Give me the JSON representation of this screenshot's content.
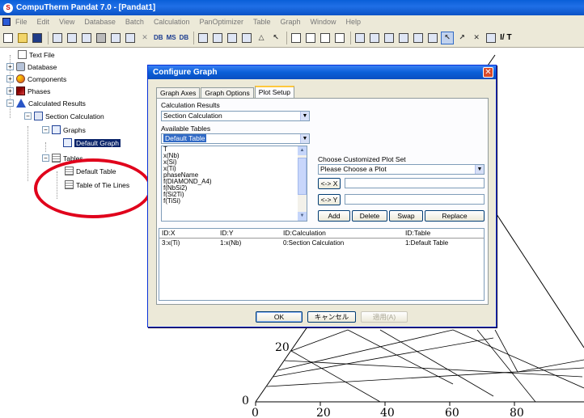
{
  "app": {
    "title": "CompuTherm Pandat 7.0 - [Pandat1]",
    "icon_label": "S",
    "menu": [
      "File",
      "Edit",
      "View",
      "Database",
      "Batch",
      "Calculation",
      "PanOptimizer",
      "Table",
      "Graph",
      "Window",
      "Help"
    ]
  },
  "toolbar": {
    "text_buttons": [
      "DB",
      "MS",
      "DB"
    ],
    "tail_text": "I/ T"
  },
  "tree": {
    "items": [
      {
        "label": "Text File",
        "icon": "text-file-icon"
      },
      {
        "label": "Database",
        "icon": "database-icon"
      },
      {
        "label": "Components",
        "icon": "components-icon"
      },
      {
        "label": "Phases",
        "icon": "phases-icon"
      },
      {
        "label": "Calculated Results",
        "icon": "calculated-results-icon"
      },
      {
        "label": "Section Calculation",
        "icon": "section-calculation-icon"
      },
      {
        "label": "Graphs",
        "icon": "graph-folder-icon"
      },
      {
        "label": "Default Graph",
        "icon": "graph-icon",
        "selected": true
      },
      {
        "label": "Tables",
        "icon": "table-folder-icon"
      },
      {
        "label": "Default Table",
        "icon": "table-icon"
      },
      {
        "label": "Table of Tie Lines",
        "icon": "table-icon"
      }
    ]
  },
  "graph": {
    "y_ticks": [
      "20",
      "0"
    ],
    "x_ticks": [
      "0",
      "20",
      "40",
      "60",
      "80"
    ]
  },
  "dialog": {
    "title": "Configure Graph",
    "tabs": [
      "Graph Axes",
      "Graph Options",
      "Plot Setup"
    ],
    "active_tab": "Plot Setup",
    "calc_results_label": "Calculation Results",
    "calc_results_value": "Section Calculation",
    "available_tables_label": "Available Tables",
    "available_tables_value": "Default Table",
    "columns_list": [
      "T",
      "x(Nb)",
      "x(Si)",
      "x(Ti)",
      "phaseName",
      "f(DIAMOND_A4)",
      "f(NbSi2)",
      "f(Si2Ti)",
      "f(TiSi)"
    ],
    "plot_set_label": "Choose Customized Plot Set",
    "plot_set_value": "Please Choose a Plot",
    "x_button": "<-> X",
    "y_button": "<-> Y",
    "action_buttons": [
      "Add",
      "Delete",
      "Swap",
      "Replace"
    ],
    "grid_headers": [
      "ID:X",
      "ID:Y",
      "ID:Calculation",
      "ID:Table"
    ],
    "grid_rows": [
      [
        "3:x(Ti)",
        "1:x(Nb)",
        "0:Section Calculation",
        "1:Default Table"
      ]
    ],
    "ok_label": "OK",
    "cancel_label": "キャンセル",
    "apply_label": "適用(A)"
  }
}
